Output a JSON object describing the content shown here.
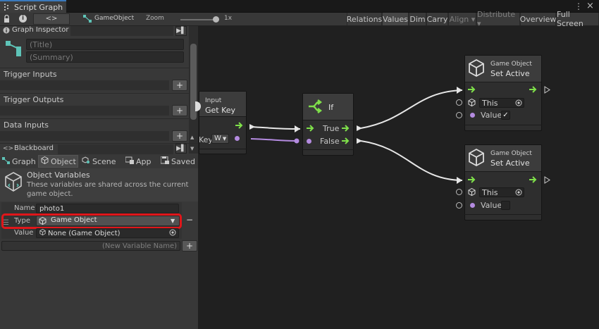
{
  "window": {
    "tab_title": "Script Graph"
  },
  "toolbar": {
    "nav_label": "<>",
    "breadcrumb": "GameObject",
    "zoom_label": "Zoom",
    "zoom_value": "1x",
    "zoom_level_fraction": 0.9,
    "buttons": [
      "Relations",
      "Values",
      "Dim",
      "Carry",
      "Align ▾",
      "Distribute ▾",
      "Overview",
      "Full Screen"
    ]
  },
  "graph_inspector": {
    "title": "Graph Inspector",
    "title_placeholder": "(Title)",
    "summary_placeholder": "(Summary)",
    "sections": [
      "Trigger Inputs",
      "Trigger Outputs",
      "Data Inputs"
    ],
    "add_label": "+"
  },
  "blackboard": {
    "title": "Blackboard",
    "tabs": [
      "Graph",
      "Object",
      "Scene",
      "App",
      "Saved"
    ],
    "heading": "Object Variables",
    "description": "These variables are shared across the current game object.",
    "variable": {
      "name_label": "Name",
      "name_value": "photo1",
      "type_label": "Type",
      "type_value": "Game Object",
      "value_label": "Value",
      "value_value": "None (Game Object)",
      "remove_label": "−"
    },
    "new_variable_placeholder": "(New Variable Name)",
    "add_label": "+"
  },
  "graph": {
    "input_node": {
      "category": "Input",
      "title": "Get Key",
      "key_label": "Key",
      "key_value": "W"
    },
    "if_node": {
      "title": "If",
      "true_label": "True",
      "false_label": "False"
    },
    "set_active_nodes": [
      {
        "category": "Game Object",
        "title": "Set Active",
        "target_value": "This",
        "value_label": "Value",
        "value_checked": true,
        "check_mark": "✓"
      },
      {
        "category": "Game Object",
        "title": "Set Active",
        "target_value": "This",
        "value_label": "Value",
        "value_checked": false,
        "check_mark": ""
      }
    ]
  },
  "colors": {
    "accent": "#3a79bb",
    "control_port": "#7fe04a",
    "value_port": "#b48be0",
    "highlight": "#e0161a"
  }
}
